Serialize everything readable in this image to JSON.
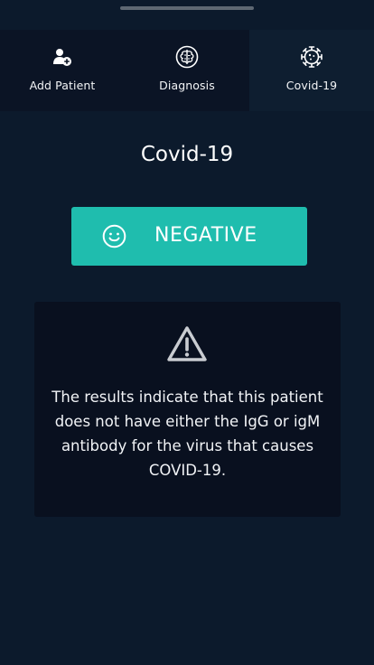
{
  "tabs": [
    {
      "label": "Add Patient",
      "icon": "add-patient-icon",
      "active": false
    },
    {
      "label": "Diagnosis",
      "icon": "brain-icon",
      "active": false
    },
    {
      "label": "Covid-19",
      "icon": "virus-icon",
      "active": true
    }
  ],
  "page": {
    "title": "Covid-19"
  },
  "result": {
    "label": "NEGATIVE",
    "icon": "smile-icon",
    "color": "#1fbdae"
  },
  "info": {
    "icon": "warning-icon",
    "message": "The results indicate that this patient does not have either the IgG or igM antibody for the virus that causes COVID-19."
  },
  "colors": {
    "background": "#0c1a2c",
    "tabbar": "#0b1425",
    "card": "#09101f",
    "accent": "#1fbdae"
  }
}
